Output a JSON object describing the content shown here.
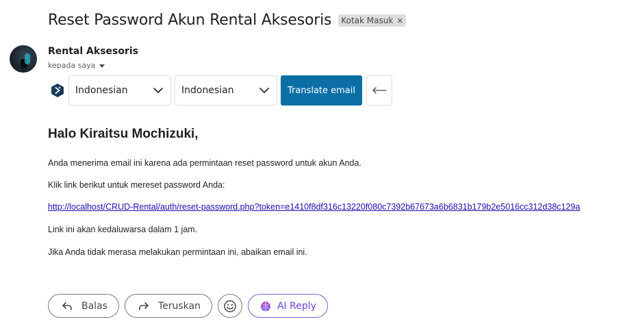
{
  "email": {
    "subject": "Reset Password Akun Rental Aksesoris",
    "label": "Kotak Masuk",
    "label_remove": "×",
    "sender_name": "Rental Aksesoris",
    "recipient_text": "kepada saya"
  },
  "translate": {
    "source_language": "Indonesian",
    "target_language": "Indonesian",
    "button_label": "Translate email",
    "back_symbol": "⟵",
    "accent_color": "#0b6fa6"
  },
  "body": {
    "greeting": "Halo Kiraitsu Mochizuki,",
    "line1": "Anda menerima email ini karena ada permintaan reset password untuk akun Anda.",
    "line2": "Klik link berikut untuk mereset password Anda:",
    "reset_link": "http://localhost/CRUD-Rental/auth/reset-password.php?token=e1410f8df316c13220f080c7392b67673a6b6831b179b2e5016cc312d38c129a",
    "line3": "Link ini akan kedaluwarsa dalam 1 jam.",
    "line4": "Jika Anda tidak merasa melakukan permintaan ini, abaikan email ini."
  },
  "actions": {
    "reply_label": "Balas",
    "forward_label": "Teruskan",
    "ai_reply_label": "AI Reply",
    "icons": [
      "reply-icon",
      "forward-icon",
      "emoji-icon",
      "ai-brain-icon"
    ]
  }
}
